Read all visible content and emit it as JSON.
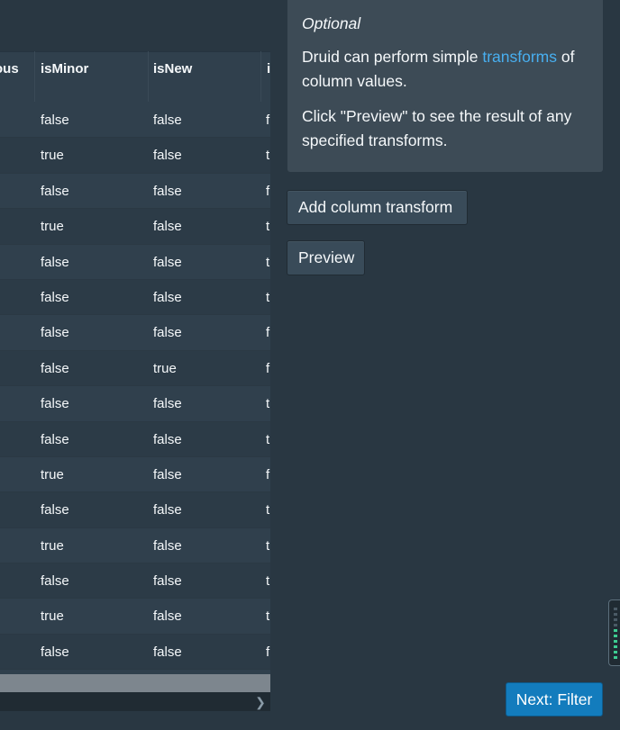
{
  "table": {
    "columns": [
      "ous",
      "isMinor",
      "isNew",
      "i"
    ],
    "rows": [
      {
        "isMinor": "false",
        "isNew": "false",
        "next": "f"
      },
      {
        "isMinor": "true",
        "isNew": "false",
        "next": "t"
      },
      {
        "isMinor": "false",
        "isNew": "false",
        "next": "f"
      },
      {
        "isMinor": "true",
        "isNew": "false",
        "next": "t"
      },
      {
        "isMinor": "false",
        "isNew": "false",
        "next": "t"
      },
      {
        "isMinor": "false",
        "isNew": "false",
        "next": "t"
      },
      {
        "isMinor": "false",
        "isNew": "false",
        "next": "f"
      },
      {
        "isMinor": "false",
        "isNew": "true",
        "next": "f"
      },
      {
        "isMinor": "false",
        "isNew": "false",
        "next": "t"
      },
      {
        "isMinor": "false",
        "isNew": "false",
        "next": "t"
      },
      {
        "isMinor": "true",
        "isNew": "false",
        "next": "f"
      },
      {
        "isMinor": "false",
        "isNew": "false",
        "next": "t"
      },
      {
        "isMinor": "true",
        "isNew": "false",
        "next": "t"
      },
      {
        "isMinor": "false",
        "isNew": "false",
        "next": "t"
      },
      {
        "isMinor": "true",
        "isNew": "false",
        "next": "t"
      },
      {
        "isMinor": "false",
        "isNew": "false",
        "next": "f"
      }
    ],
    "scroll_right_icon": "chevron-right-icon"
  },
  "info": {
    "title": "Optional",
    "text_before_link": "Druid can perform simple ",
    "link_text": "transforms",
    "text_after_link": " of column values.",
    "preview_hint": "Click \"Preview\" to see the result of any specified transforms."
  },
  "actions": {
    "add_column_transform": "Add column transform",
    "preview": "Preview",
    "next": "Next: Filter"
  },
  "colors": {
    "background": "#293742",
    "link": "#48aff0",
    "primary_button": "#137cbd"
  }
}
